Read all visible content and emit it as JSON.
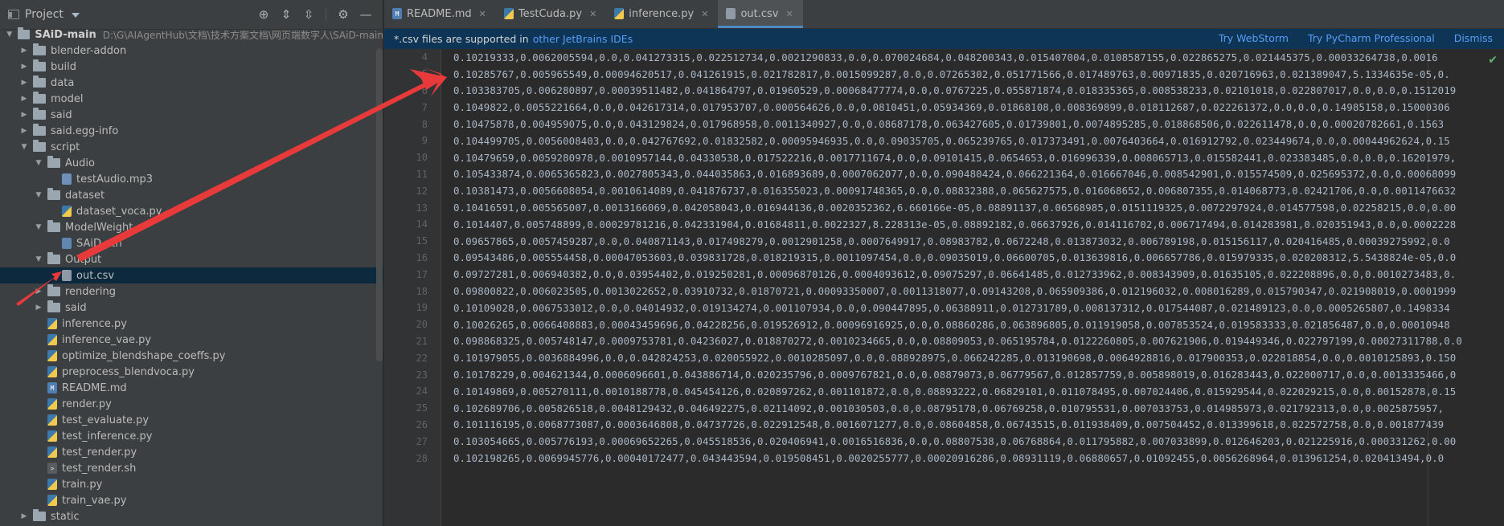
{
  "project_panel": {
    "title": "Project",
    "root_name": "SAiD-main",
    "root_path": "D:\\G\\AIAgentHub\\文档\\技术方案文档\\网页端数字人\\SAiD-main",
    "tool_icons": [
      "target-icon",
      "expand-icon",
      "collapse-icon",
      "gear-icon",
      "minimize-icon"
    ],
    "items": [
      {
        "label": "blender-addon",
        "type": "folder",
        "depth": 1,
        "state": "collapsed"
      },
      {
        "label": "build",
        "type": "folder",
        "depth": 1,
        "state": "collapsed"
      },
      {
        "label": "data",
        "type": "folder",
        "depth": 1,
        "state": "collapsed"
      },
      {
        "label": "model",
        "type": "folder",
        "depth": 1,
        "state": "collapsed"
      },
      {
        "label": "said",
        "type": "folder",
        "depth": 1,
        "state": "collapsed"
      },
      {
        "label": "said.egg-info",
        "type": "folder",
        "depth": 1,
        "state": "collapsed"
      },
      {
        "label": "script",
        "type": "folder",
        "depth": 1,
        "state": "expanded"
      },
      {
        "label": "Audio",
        "type": "folder",
        "depth": 2,
        "state": "expanded"
      },
      {
        "label": "testAudio.mp3",
        "type": "mp3",
        "depth": 3
      },
      {
        "label": "dataset",
        "type": "folder",
        "depth": 2,
        "state": "expanded"
      },
      {
        "label": "dataset_voca.py",
        "type": "py",
        "depth": 3
      },
      {
        "label": "ModelWeight",
        "type": "folder",
        "depth": 2,
        "state": "expanded"
      },
      {
        "label": "SAiD.pth",
        "type": "pth",
        "depth": 3
      },
      {
        "label": "Output",
        "type": "folder",
        "depth": 2,
        "state": "expanded"
      },
      {
        "label": "out.csv",
        "type": "csv",
        "depth": 3,
        "selected": true
      },
      {
        "label": "rendering",
        "type": "folder",
        "depth": 2,
        "state": "collapsed"
      },
      {
        "label": "said",
        "type": "folder",
        "depth": 2,
        "state": "collapsed"
      },
      {
        "label": "inference.py",
        "type": "py",
        "depth": 2
      },
      {
        "label": "inference_vae.py",
        "type": "py",
        "depth": 2
      },
      {
        "label": "optimize_blendshape_coeffs.py",
        "type": "py",
        "depth": 2
      },
      {
        "label": "preprocess_blendvoca.py",
        "type": "py",
        "depth": 2
      },
      {
        "label": "README.md",
        "type": "md",
        "depth": 2
      },
      {
        "label": "render.py",
        "type": "py",
        "depth": 2
      },
      {
        "label": "test_evaluate.py",
        "type": "py",
        "depth": 2
      },
      {
        "label": "test_inference.py",
        "type": "py",
        "depth": 2
      },
      {
        "label": "test_render.py",
        "type": "py",
        "depth": 2
      },
      {
        "label": "test_render.sh",
        "type": "sh",
        "depth": 2
      },
      {
        "label": "train.py",
        "type": "py",
        "depth": 2
      },
      {
        "label": "train_vae.py",
        "type": "py",
        "depth": 2
      },
      {
        "label": "static",
        "type": "folder",
        "depth": 1,
        "state": "collapsed"
      }
    ]
  },
  "tabs": [
    {
      "label": "README.md",
      "icon": "md",
      "active": false
    },
    {
      "label": "TestCuda.py",
      "icon": "py",
      "active": false
    },
    {
      "label": "inference.py",
      "icon": "py",
      "active": false
    },
    {
      "label": "out.csv",
      "icon": "csv",
      "active": true
    }
  ],
  "banner": {
    "text": "*.csv files are supported in",
    "link": "other JetBrains IDEs",
    "actions": [
      "Try WebStorm",
      "Try PyCharm Professional",
      "Dismiss"
    ]
  },
  "editor_lines": [
    {
      "num": "4",
      "text": "0.10219333,0.0062005594,0.0,0.041273315,0.022512734,0.0021290833,0.0,0.070024684,0.048200343,0.015407004,0.0108587155,0.022865275,0.021445375,0.00033264738,0.0016"
    },
    {
      "num": "5",
      "text": "0.10285767,0.005965549,0.00094620517,0.041261915,0.021782817,0.0015099287,0.0,0.07265302,0.051771566,0.017489763,0.00971835,0.020716963,0.021389047,5.1334635e-05,0."
    },
    {
      "num": "6",
      "text": "0.103383705,0.006280897,0.00039511482,0.041864797,0.01960529,0.00068477774,0.0,0.0767225,0.055871874,0.018335365,0.008538233,0.02101018,0.022807017,0.0,0.0,0.1512019"
    },
    {
      "num": "7",
      "text": "0.1049822,0.0055221664,0.0,0.042617314,0.017953707,0.000564626,0.0,0.0810451,0.05934369,0.01868108,0.008369899,0.018112687,0.022261372,0.0,0.0,0.14985158,0.15000306"
    },
    {
      "num": "8",
      "text": "0.10475878,0.004959075,0.0,0.043129824,0.017968958,0.0011340927,0.0,0.08687178,0.063427605,0.01739801,0.0074895285,0.018868506,0.022611478,0.0,0.00020782661,0.1563"
    },
    {
      "num": "9",
      "text": "0.104499705,0.0056008403,0.0,0.042767692,0.01832582,0.00095946935,0.0,0.09035705,0.065239765,0.017373491,0.0076403664,0.016912792,0.023449674,0.0,0.00044962624,0.15"
    },
    {
      "num": "10",
      "text": "0.10479659,0.0059280978,0.0010957144,0.04330538,0.017522216,0.0017711674,0.0,0.09101415,0.0654653,0.016996339,0.008065713,0.015582441,0.023383485,0.0,0.0,0.16201979,"
    },
    {
      "num": "11",
      "text": "0.105433874,0.0065365823,0.0027805343,0.044035863,0.016893689,0.0007062077,0.0,0.090480424,0.066221364,0.016667046,0.008542901,0.015574509,0.025695372,0.0,0.00068099"
    },
    {
      "num": "12",
      "text": "0.10381473,0.0056608054,0.0010614089,0.041876737,0.016355023,0.00091748365,0.0,0.08832388,0.065627575,0.016068652,0.006807355,0.014068773,0.02421706,0.0,0.0011476632"
    },
    {
      "num": "13",
      "text": "0.10416591,0.005565007,0.0013166069,0.042058043,0.016944136,0.0020352362,6.660166e-05,0.08891137,0.06568985,0.0151119325,0.0072297924,0.014577598,0.02258215,0.0,0.00"
    },
    {
      "num": "14",
      "text": "0.1014407,0.005748899,0.00029781216,0.042331904,0.01684811,0.0022327,8.228313e-05,0.08892182,0.06637926,0.014116702,0.006717494,0.014283981,0.020351943,0.0,0.0002228"
    },
    {
      "num": "15",
      "text": "0.09657865,0.0057459287,0.0,0.040871143,0.017498279,0.0012901258,0.0007649917,0.08983782,0.0672248,0.013873032,0.006789198,0.015156117,0.020416485,0.00039275992,0.0"
    },
    {
      "num": "16",
      "text": "0.09543486,0.005554458,0.00047053603,0.039831728,0.018219315,0.0011097454,0.0,0.09035019,0.06600705,0.013639816,0.006657786,0.015979335,0.020208312,5.5438824e-05,0.0"
    },
    {
      "num": "17",
      "text": "0.09727281,0.006940382,0.0,0.03954402,0.019250281,0.00096870126,0.0004093612,0.09075297,0.06641485,0.012733962,0.008343909,0.01635105,0.022208896,0.0,0.0010273483,0."
    },
    {
      "num": "18",
      "text": "0.09800822,0.006023505,0.0013022652,0.03910732,0.01870721,0.00093350007,0.0011318077,0.09143208,0.065909386,0.012196032,0.008016289,0.015790347,0.021908019,0.0001999"
    },
    {
      "num": "19",
      "text": "0.10109028,0.0067533012,0.0,0.04014932,0.019134274,0.001107934,0.0,0.090447895,0.06388911,0.012731789,0.008137312,0.017544087,0.021489123,0.0,0.0005265807,0.1498334"
    },
    {
      "num": "20",
      "text": "0.10026265,0.0066408883,0.00043459696,0.04228256,0.019526912,0.00096916925,0.0,0.08860286,0.063896805,0.011919058,0.007853524,0.019583333,0.021856487,0.0,0.00010948"
    },
    {
      "num": "21",
      "text": "0.098868325,0.005748147,0.0009753781,0.04236027,0.018870272,0.0010234665,0.0,0.08809053,0.065195784,0.0122260805,0.007621906,0.019449346,0.022797199,0.00027311788,0.0"
    },
    {
      "num": "22",
      "text": "0.101979055,0.0036884996,0.0,0.042824253,0.020055922,0.0010285097,0.0,0.088928975,0.066242285,0.013190698,0.0064928816,0.017900353,0.022818854,0.0,0.0010125893,0.150"
    },
    {
      "num": "23",
      "text": "0.10178229,0.004621344,0.0006096601,0.043886714,0.020235796,0.0009767821,0.0,0.08879073,0.06779567,0.012857759,0.005898019,0.016283443,0.022000717,0.0,0.0013335466,0"
    },
    {
      "num": "24",
      "text": "0.10149869,0.005270111,0.0010188778,0.045454126,0.020897262,0.001101872,0.0,0.08893222,0.06829101,0.011078495,0.007024406,0.015929544,0.022029215,0.0,0.00152878,0.15"
    },
    {
      "num": "25",
      "text": "0.102689706,0.005826518,0.0048129432,0.046492275,0.02114092,0.001030503,0.0,0.08795178,0.06769258,0.010795531,0.007033753,0.014985973,0.021792313,0.0,0.0025875957,"
    },
    {
      "num": "26",
      "text": "0.101116195,0.0068773087,0.0003646808,0.04737726,0.022912548,0.0016071277,0.0,0.08604858,0.06743515,0.011938409,0.007504452,0.013399618,0.022572758,0.0,0.001877439"
    },
    {
      "num": "27",
      "text": "0.103054665,0.005776193,0.00069652265,0.045518536,0.020406941,0.0016516836,0.0,0.08807538,0.06768864,0.011795882,0.007033899,0.012646203,0.021225916,0.000331262,0.00"
    },
    {
      "num": "28",
      "text": "0.102198265,0.0069945776,0.00040172477,0.043443594,0.019508451,0.0020255777,0.00020916286,0.08931119,0.06880657,0.01092455,0.0056268964,0.013961254,0.020413494,0.0"
    }
  ],
  "colors": {
    "accent": "#4a88c7",
    "banner_bg": "#0e3556",
    "link": "#589df6",
    "arrow": "#e83a3a",
    "selection": "#0d293e"
  }
}
